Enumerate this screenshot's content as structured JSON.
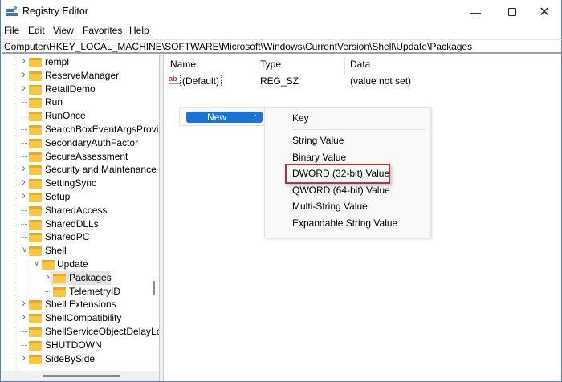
{
  "window": {
    "title": "Registry Editor",
    "controls": [
      "minimize",
      "maximize",
      "close"
    ]
  },
  "menubar": [
    "File",
    "Edit",
    "View",
    "Favorites",
    "Help"
  ],
  "address": "Computer\\HKEY_LOCAL_MACHINE\\SOFTWARE\\Microsoft\\Windows\\CurrentVersion\\Shell\\Update\\Packages",
  "tree": [
    {
      "label": "rempl",
      "level": 1,
      "expander": "collapsed"
    },
    {
      "label": "ReserveManager",
      "level": 1,
      "expander": "collapsed"
    },
    {
      "label": "RetailDemo",
      "level": 1,
      "expander": "collapsed"
    },
    {
      "label": "Run",
      "level": 1,
      "expander": "none"
    },
    {
      "label": "RunOnce",
      "level": 1,
      "expander": "none"
    },
    {
      "label": "SearchBoxEventArgsProvi",
      "level": 1,
      "expander": "none"
    },
    {
      "label": "SecondaryAuthFactor",
      "level": 1,
      "expander": "none"
    },
    {
      "label": "SecureAssessment",
      "level": 1,
      "expander": "none"
    },
    {
      "label": "Security and Maintenance",
      "level": 1,
      "expander": "collapsed"
    },
    {
      "label": "SettingSync",
      "level": 1,
      "expander": "collapsed"
    },
    {
      "label": "Setup",
      "level": 1,
      "expander": "collapsed"
    },
    {
      "label": "SharedAccess",
      "level": 1,
      "expander": "none"
    },
    {
      "label": "SharedDLLs",
      "level": 1,
      "expander": "none"
    },
    {
      "label": "SharedPC",
      "level": 1,
      "expander": "none"
    },
    {
      "label": "Shell",
      "level": 1,
      "expander": "expanded"
    },
    {
      "label": "Update",
      "level": 2,
      "expander": "expanded"
    },
    {
      "label": "Packages",
      "level": 3,
      "expander": "collapsed",
      "selected": true
    },
    {
      "label": "TelemetryID",
      "level": 3,
      "expander": "none"
    },
    {
      "label": "Shell Extensions",
      "level": 1,
      "expander": "collapsed"
    },
    {
      "label": "ShellCompatibility",
      "level": 1,
      "expander": "collapsed"
    },
    {
      "label": "ShellServiceObjectDelayLo",
      "level": 1,
      "expander": "none"
    },
    {
      "label": "SHUTDOWN",
      "level": 1,
      "expander": "none"
    },
    {
      "label": "SideBySide",
      "level": 1,
      "expander": "collapsed"
    }
  ],
  "list": {
    "columns": [
      "Name",
      "Type",
      "Data"
    ],
    "rows": [
      {
        "name": "(Default)",
        "type": "REG_SZ",
        "data": "(value not set)",
        "icon": "string-value-icon"
      }
    ]
  },
  "context_menu": {
    "item": "New"
  },
  "submenu": {
    "items": [
      "Key",
      "String Value",
      "Binary Value",
      "DWORD (32-bit) Value",
      "QWORD (64-bit) Value",
      "Multi-String Value",
      "Expandable String Value"
    ],
    "highlighted": "DWORD (32-bit) Value"
  },
  "colors": {
    "accent": "#1a73d9",
    "highlight_box": "#b5303a",
    "folder": "#f6c744"
  }
}
